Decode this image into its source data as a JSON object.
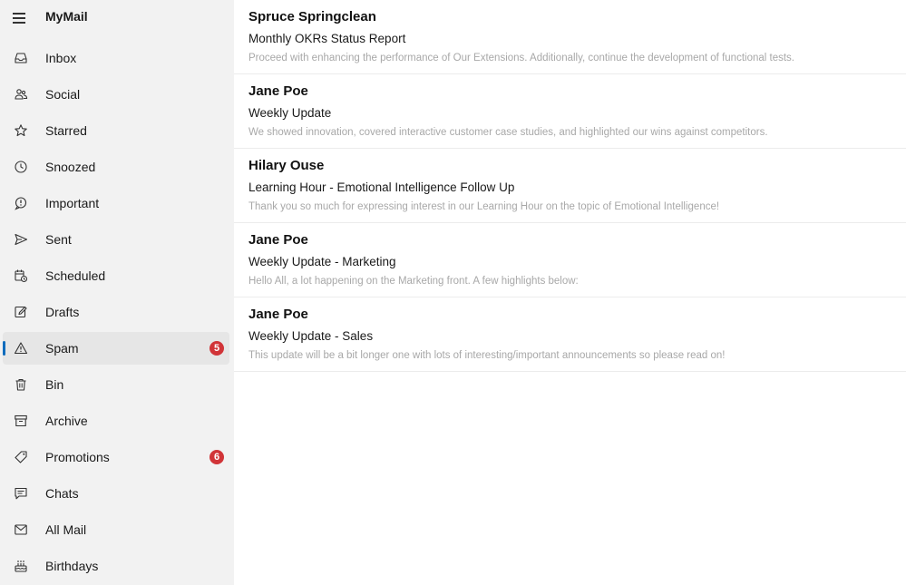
{
  "app": {
    "title": "MyMail"
  },
  "sidebar": {
    "items": [
      {
        "label": "Inbox",
        "icon": "inbox-icon"
      },
      {
        "label": "Social",
        "icon": "people-icon"
      },
      {
        "label": "Starred",
        "icon": "star-icon"
      },
      {
        "label": "Snoozed",
        "icon": "clock-icon"
      },
      {
        "label": "Important",
        "icon": "important-icon"
      },
      {
        "label": "Sent",
        "icon": "send-icon"
      },
      {
        "label": "Scheduled",
        "icon": "calendar-icon"
      },
      {
        "label": "Drafts",
        "icon": "pencil-icon"
      },
      {
        "label": "Spam",
        "icon": "warning-icon",
        "badge": "5",
        "active": true
      },
      {
        "label": "Bin",
        "icon": "trash-icon"
      },
      {
        "label": "Archive",
        "icon": "archive-icon"
      },
      {
        "label": "Promotions",
        "icon": "tag-icon",
        "badge": "6"
      },
      {
        "label": "Chats",
        "icon": "chat-icon"
      },
      {
        "label": "All Mail",
        "icon": "mail-icon"
      },
      {
        "label": "Birthdays",
        "icon": "cake-icon"
      }
    ]
  },
  "mails": [
    {
      "sender": "Spruce Springclean",
      "subject": "Monthly OKRs Status Report",
      "preview": "Proceed with enhancing the performance of Our Extensions. Additionally, continue the development of functional tests."
    },
    {
      "sender": "Jane Poe",
      "subject": "Weekly Update",
      "preview": "We showed innovation, covered interactive customer case studies, and highlighted our wins against competitors."
    },
    {
      "sender": "Hilary Ouse",
      "subject": "Learning Hour - Emotional Intelligence Follow Up",
      "preview": "Thank you so much for expressing interest in our Learning Hour on the topic of Emotional Intelligence!"
    },
    {
      "sender": "Jane Poe",
      "subject": "Weekly Update - Marketing",
      "preview": "Hello All, a lot happening on the Marketing front. A few highlights below:"
    },
    {
      "sender": "Jane Poe",
      "subject": "Weekly Update - Sales",
      "preview": "This update will be a bit longer one with lots of interesting/important announcements so please read on!"
    }
  ],
  "colors": {
    "accent": "#0f6cbd",
    "badge": "#d13438",
    "sidebar_bg": "#f2f2f2"
  }
}
